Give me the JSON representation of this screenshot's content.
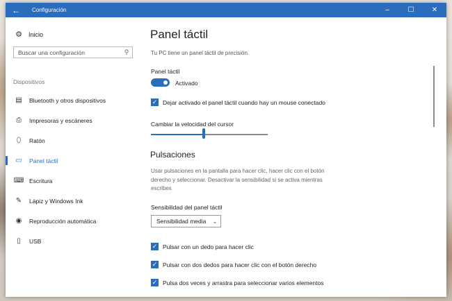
{
  "window": {
    "title": "Configuración",
    "back_icon": "arrow-left-icon",
    "controls": {
      "minimize": "–",
      "maximize": "☐",
      "close": "✕"
    }
  },
  "sidebar": {
    "home_label": "Inicio",
    "search_placeholder": "Buscar una configuración",
    "section_label": "Dispositivos",
    "items": [
      {
        "label": "Bluetooth y otros dispositivos",
        "icon": "bluetooth-devices-icon",
        "active": false
      },
      {
        "label": "Impresoras y escáneres",
        "icon": "printer-icon",
        "active": false
      },
      {
        "label": "Ratón",
        "icon": "mouse-icon",
        "active": false
      },
      {
        "label": "Panel táctil",
        "icon": "touchpad-icon",
        "active": true
      },
      {
        "label": "Escritura",
        "icon": "keyboard-icon",
        "active": false
      },
      {
        "label": "Lápiz y Windows Ink",
        "icon": "pen-icon",
        "active": false
      },
      {
        "label": "Reproducción automática",
        "icon": "autoplay-icon",
        "active": false
      },
      {
        "label": "USB",
        "icon": "usb-icon",
        "active": false
      }
    ]
  },
  "main": {
    "title": "Panel táctil",
    "subtitle": "Tu PC tiene un panel táctil de precisión.",
    "touchpad_label": "Panel táctil",
    "toggle_state": "Activado",
    "leave_on_checkbox": "Dejar activado el panel táctil cuando hay un mouse conectado",
    "cursor_speed_label": "Cambiar la velocidad del cursor",
    "cursor_speed_level": 0.45,
    "taps_heading": "Pulsaciones",
    "taps_description": "Usar pulsaciones en la pantalla para hacer clic, hacer clic con el botón derecho y seleccionar. Desactivar la sensibilidad si se activa mientras escribes",
    "sensitivity_label": "Sensibilidad del panel táctil",
    "sensitivity_value": "Sensibilidad media",
    "tap_options": [
      "Pulsar con un dedo para hacer clic",
      "Pulsar con dos dedos para hacer clic con el botón derecho",
      "Pulsa dos veces y arrastra para seleccionar varios elementos"
    ]
  },
  "colors": {
    "accent": "#2b6cbd"
  }
}
